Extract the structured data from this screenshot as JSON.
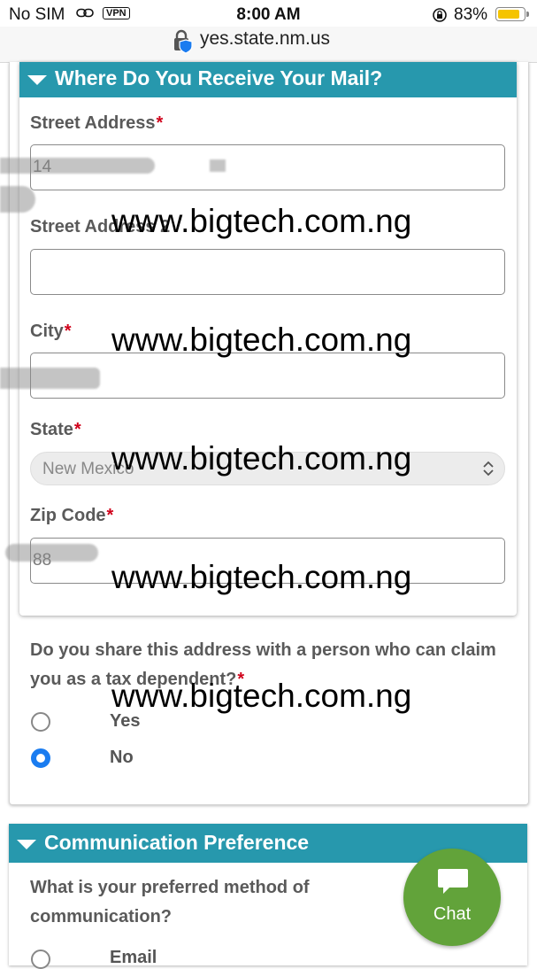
{
  "status_bar": {
    "carrier": "No SIM",
    "vpn": "VPN",
    "time": "8:00 AM",
    "battery": "83%",
    "battery_level": 0.83,
    "battery_color": "#f5c400"
  },
  "browser": {
    "url": "yes.state.nm.us"
  },
  "mail_section": {
    "title": "Where Do You Receive Your Mail?",
    "street1_label": "Street Address",
    "street1_value": "14",
    "street2_label": "Street Address 2",
    "street2_value": "",
    "city_label": "City",
    "city_value": "",
    "state_label": "State",
    "state_value": "New Mexico",
    "zip_label": "Zip Code",
    "zip_value": "88",
    "required_mark": "*"
  },
  "dependent_question": {
    "text": "Do you share this address with a person who can claim you as a tax dependent?",
    "required_mark": "*",
    "options": [
      {
        "label": "Yes",
        "selected": false
      },
      {
        "label": "No",
        "selected": true
      }
    ]
  },
  "communication_section": {
    "title": "Communication Preference",
    "question": "What is your preferred method of communication?",
    "first_option": "Email"
  },
  "watermark": "www.bigtech.com.ng",
  "chat": {
    "label": "Chat"
  },
  "colors": {
    "section_header": "#2798ad",
    "required": "#d0021b",
    "radio_selected": "#1a7cf0",
    "chat_button": "#62a33a"
  }
}
